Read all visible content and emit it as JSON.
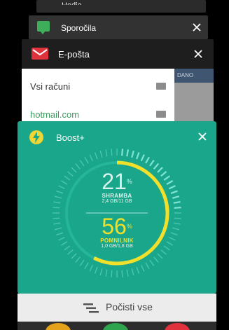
{
  "recents": [
    {
      "app": "Hedia",
      "close_label": "close"
    },
    {
      "app": "Sporočila",
      "close_label": "close"
    },
    {
      "app": "E-pošta",
      "close_label": "close"
    }
  ],
  "mail": {
    "all_accounts": "Vsi računi",
    "account": "hotmail.com",
    "side_strip": "DANO"
  },
  "boost": {
    "title": "Boost+",
    "storage": {
      "percent": "21",
      "percent_sign": "%",
      "label": "SHRAMBA",
      "detail": "2,4 GB/11 GB",
      "fraction": 0.21
    },
    "memory": {
      "percent": "56",
      "percent_sign": "%",
      "label": "POMNILNIK",
      "detail": "1,0 GB/1,8 GB",
      "fraction": 0.56
    },
    "colors": {
      "card": "#1aa68a",
      "accent": "#f1e02b",
      "ticks": "#7fe3d9"
    }
  },
  "clear_all": {
    "label": "Počisti vse"
  }
}
